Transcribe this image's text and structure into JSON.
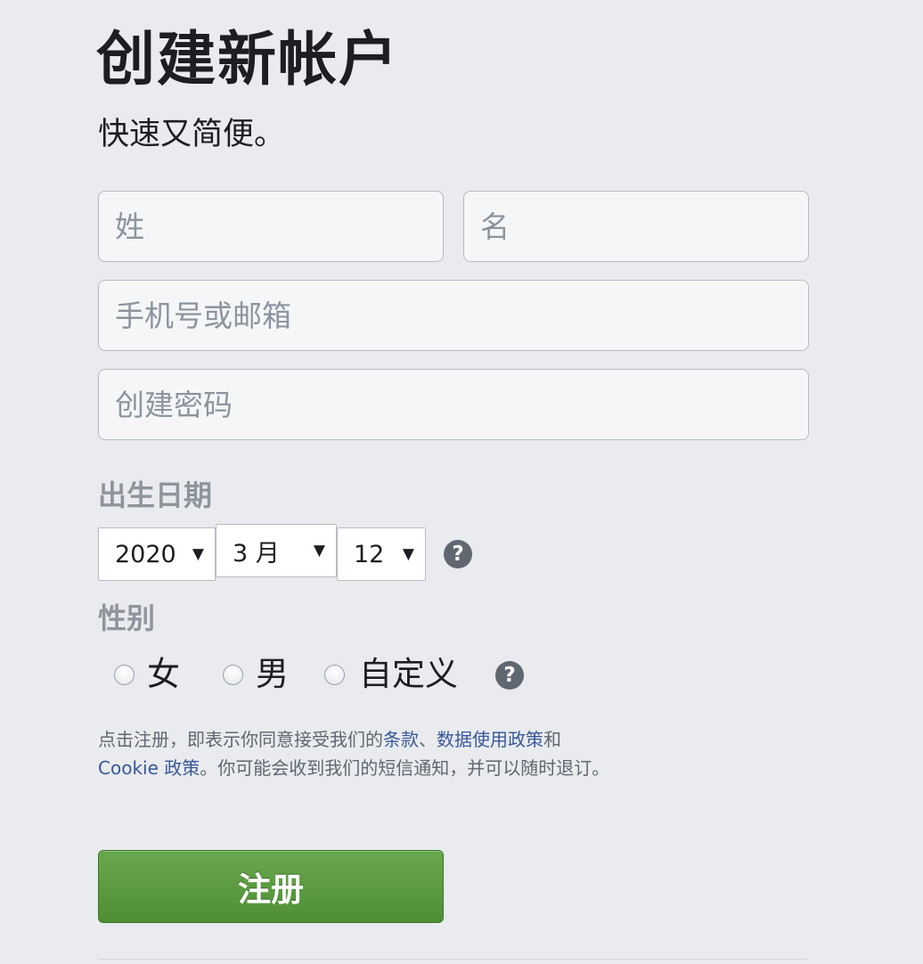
{
  "page": {
    "title": "创建新帐户",
    "subtitle": "快速又简便。"
  },
  "form": {
    "last_name_placeholder": "姓",
    "first_name_placeholder": "名",
    "contact_placeholder": "手机号或邮箱",
    "password_placeholder": "创建密码"
  },
  "birthday": {
    "label": "出生日期",
    "year": "2020",
    "month": "3 月",
    "day": "12",
    "caret": "▼",
    "help": "?"
  },
  "gender": {
    "label": "性别",
    "options": [
      {
        "label": "女"
      },
      {
        "label": "男"
      },
      {
        "label": "自定义"
      }
    ],
    "help": "?"
  },
  "terms": {
    "prefix": "点击注册，即表示你同意接受我们的",
    "terms_link": "条款",
    "separator": "、",
    "data_policy_link": "数据使用政策",
    "conjunction": "和",
    "cookie_policy_link": "Cookie 政策",
    "suffix": "。你可能会收到我们的短信通知，并可以随时退订。"
  },
  "signup_button": {
    "label": "注册"
  },
  "colors": {
    "page_background": "#e9ebee",
    "link": "#385898",
    "button_green": "#5b9b3f",
    "label_gray": "#90949c"
  }
}
